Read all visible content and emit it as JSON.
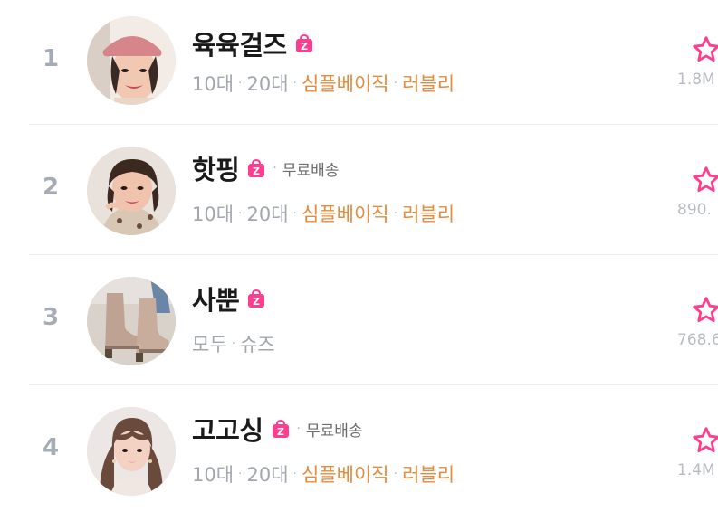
{
  "colors": {
    "accent_pink": "#ff3d8f",
    "tag_orange": "#e88a3c",
    "tag_gray": "#a2a7ae",
    "rank_gray": "#a6acb5"
  },
  "rows": [
    {
      "rank": "1",
      "name": "육육걸즈",
      "badge_icon": "z-bag-icon",
      "free_shipping": "",
      "tags": [
        {
          "text": "10대",
          "style": "gray"
        },
        {
          "text": "20대",
          "style": "gray"
        },
        {
          "text": "심플베이직",
          "style": "orange"
        },
        {
          "text": "러블리",
          "style": "orange"
        }
      ],
      "favorites": "1.8M",
      "star_icon": "star-outline-icon"
    },
    {
      "rank": "2",
      "name": "핫핑",
      "badge_icon": "z-bag-icon",
      "free_shipping": "무료배송",
      "tags": [
        {
          "text": "10대",
          "style": "gray"
        },
        {
          "text": "20대",
          "style": "gray"
        },
        {
          "text": "심플베이직",
          "style": "orange"
        },
        {
          "text": "러블리",
          "style": "orange"
        }
      ],
      "favorites": "890.",
      "star_icon": "star-outline-icon"
    },
    {
      "rank": "3",
      "name": "사뿐",
      "badge_icon": "z-bag-icon",
      "free_shipping": "",
      "tags": [
        {
          "text": "모두",
          "style": "gray"
        },
        {
          "text": "슈즈",
          "style": "gray"
        }
      ],
      "favorites": "768.6",
      "star_icon": "star-outline-icon"
    },
    {
      "rank": "4",
      "name": "고고싱",
      "badge_icon": "z-bag-icon",
      "free_shipping": "무료배송",
      "tags": [
        {
          "text": "10대",
          "style": "gray"
        },
        {
          "text": "20대",
          "style": "gray"
        },
        {
          "text": "심플베이직",
          "style": "orange"
        },
        {
          "text": "러블리",
          "style": "orange"
        }
      ],
      "favorites": "1.4M",
      "star_icon": "star-outline-icon"
    }
  ]
}
